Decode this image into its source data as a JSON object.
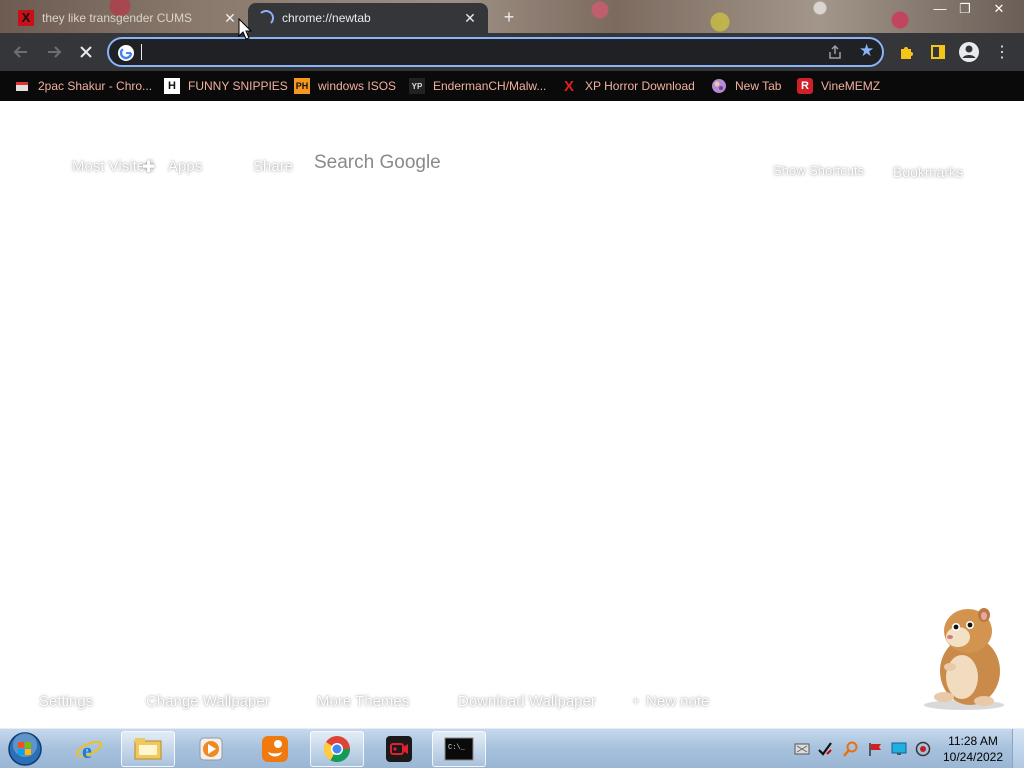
{
  "tabs": [
    {
      "title": "they like transgender CUMS",
      "active": false
    },
    {
      "title": "chrome://newtab",
      "active": true
    }
  ],
  "omnibox": {
    "value": "",
    "placeholder": ""
  },
  "bookmarks": [
    {
      "label": "2pac Shakur - Chro...",
      "icon": "bookmark-page-icon"
    },
    {
      "label": "FUNNY SNIPPIES",
      "icon": "letter-h-icon",
      "glyph": "H"
    },
    {
      "label": "windows ISOS",
      "icon": "ph-icon",
      "glyph": "PH"
    },
    {
      "label": "EndermanCH/Malw...",
      "icon": "yp-icon",
      "glyph": "YP"
    },
    {
      "label": "XP Horror Download",
      "icon": "red-x-icon",
      "glyph": "X"
    },
    {
      "label": "New Tab",
      "icon": "globe-icon"
    },
    {
      "label": "VineMEMZ",
      "icon": "letter-r-icon",
      "glyph": "R"
    }
  ],
  "newtab": {
    "most_visited": "Most Visited",
    "apps": "Apps",
    "share": "Share",
    "search": "Search Google",
    "show_shortcuts": "Show Shortcuts",
    "bookmarks": "Bookmarks",
    "settings": "Settings",
    "change_wallpaper": "Change Wallpaper",
    "more_themes": "More Themes",
    "download_wallpaper": "Download Wallpaper",
    "new_note": "New note"
  },
  "taskbar": {
    "apps": [
      "internet-explorer",
      "file-explorer",
      "media-player",
      "uc-browser",
      "chrome",
      "screen-recorder",
      "command-prompt"
    ],
    "time": "11:28 AM",
    "date": "10/24/2022"
  },
  "colors": {
    "toolbar": "#35363a",
    "omnibox_focus": "#8ab4f8",
    "bookmark_text": "#f0b0a0",
    "taskbar": "#a9c3de"
  }
}
